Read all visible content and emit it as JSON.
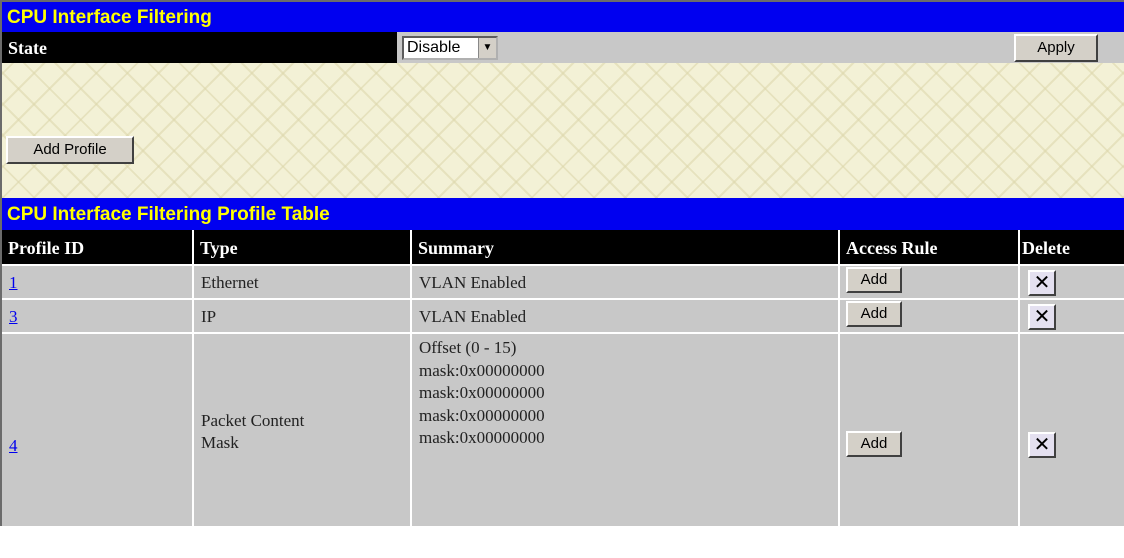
{
  "header": {
    "title": "CPU Interface Filtering"
  },
  "state": {
    "label": "State",
    "select_value": "Disable",
    "apply_label": "Apply"
  },
  "add_profile_label": "Add Profile",
  "table": {
    "title": "CPU Interface Filtering Profile Table",
    "columns": [
      "Profile ID",
      "Type",
      "Summary",
      "Access Rule",
      "Delete"
    ],
    "rows": [
      {
        "id": "1",
        "type": "Ethernet",
        "summary": [
          "VLAN Enabled"
        ],
        "access_label": "Add"
      },
      {
        "id": "3",
        "type": "IP",
        "summary": [
          "VLAN Enabled"
        ],
        "access_label": "Add"
      },
      {
        "id": "4",
        "type": "Packet Content Mask",
        "summary": [
          "Offset (0 - 15)",
          "mask:0x00000000",
          "mask:0x00000000",
          "mask:0x00000000",
          "mask:0x00000000"
        ],
        "access_label": "Add"
      }
    ]
  },
  "colors": {
    "header_bar": "#0000f0",
    "header_text": "#ffff00",
    "row_bg": "#c8c8c8"
  },
  "icons": {
    "delete": "close-icon",
    "dropdown": "chevron-down-icon"
  }
}
